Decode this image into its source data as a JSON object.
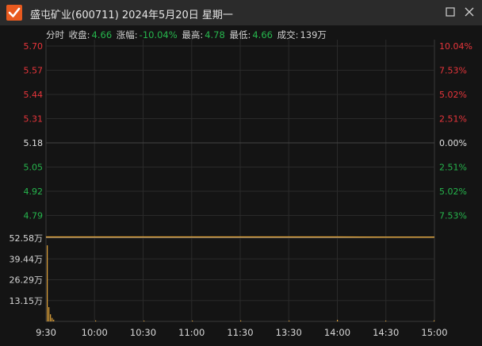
{
  "window": {
    "title": "盛屯矿业(600711) 2024年5月20日 星期一",
    "restore_icon": "restore-icon",
    "close_icon": "close-icon",
    "logo_icon": "check-logo-icon",
    "accent": "#e85a1f"
  },
  "info": {
    "mode": "分时",
    "close_label": "收盘:",
    "close_value": "4.66",
    "change_label": "涨幅:",
    "change_value": "-10.04%",
    "high_label": "最高:",
    "high_value": "4.78",
    "low_label": "最低:",
    "low_value": "4.66",
    "volume_label": "成交:",
    "volume_value": "139万"
  },
  "colors": {
    "up": "#e8353b",
    "down": "#26b64d",
    "flat": "#e0e0e0",
    "price_line": "#d9d9d9",
    "avg_line": "#e3a53a",
    "volume": "#e3a53a"
  },
  "chart_data": [
    {
      "type": "line",
      "price_ticks": [
        "5.70",
        "5.57",
        "5.44",
        "5.31",
        "5.18",
        "5.05",
        "4.92",
        "4.79"
      ],
      "pct_ticks": [
        "10.04%",
        "7.53%",
        "5.02%",
        "2.51%",
        "0.00%",
        "2.51%",
        "5.02%",
        "7.53%"
      ],
      "tick_signs": [
        "up",
        "up",
        "up",
        "up",
        "flat",
        "down",
        "down",
        "down"
      ],
      "ylim": [
        4.66,
        5.7
      ],
      "prev_close": 5.18,
      "x": [
        "9:30",
        "10:00",
        "10:30",
        "11:00",
        "11:30",
        "13:30",
        "14:00",
        "14:30",
        "15:00"
      ],
      "series": [
        {
          "values": [
            4.66,
            4.66,
            4.66,
            4.66,
            4.66,
            4.66,
            4.66,
            4.66,
            4.66
          ]
        },
        {
          "values": [
            4.662,
            4.662,
            4.662,
            4.662,
            4.662,
            4.662,
            4.662,
            4.661,
            4.661
          ]
        }
      ]
    },
    {
      "type": "bar",
      "vol_ticks": [
        "52.58万",
        "39.44万",
        "26.29万",
        "13.15万"
      ],
      "ylim": [
        0,
        52.58
      ],
      "x": [
        "9:30",
        "10:00",
        "10:30",
        "11:00",
        "11:30",
        "13:30",
        "14:00",
        "14:30",
        "15:00"
      ],
      "bars": [
        {
          "t": 0,
          "v": 48.0
        },
        {
          "t": 1,
          "v": 9.0
        },
        {
          "t": 2,
          "v": 4.5
        },
        {
          "t": 3,
          "v": 2.2
        },
        {
          "t": 4,
          "v": 1.1
        },
        {
          "t": 30,
          "v": 0.6
        },
        {
          "t": 60,
          "v": 0.5
        },
        {
          "t": 90,
          "v": 0.5
        },
        {
          "t": 120,
          "v": 0.6
        },
        {
          "t": 150,
          "v": 0.5
        },
        {
          "t": 180,
          "v": 1.0
        },
        {
          "t": 210,
          "v": 0.5
        },
        {
          "t": 240,
          "v": 0.6
        }
      ]
    }
  ]
}
